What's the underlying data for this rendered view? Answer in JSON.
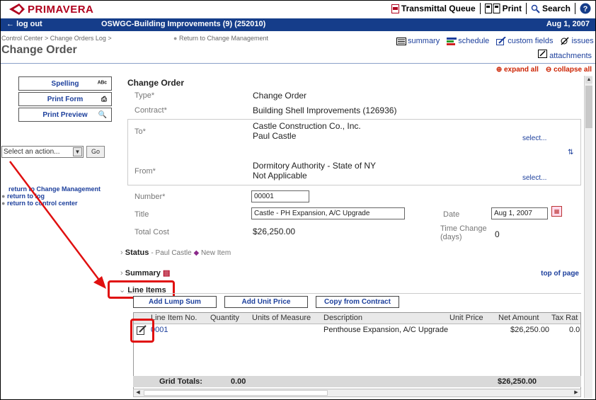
{
  "app": {
    "brand": "PRIMAVERA"
  },
  "topnav": {
    "transmittal": "Transmittal Queue",
    "print": "Print",
    "search": "Search",
    "help": "?"
  },
  "header": {
    "logout": "log out",
    "project": "OSWGC-Building Improvements (9) (252010)",
    "date": "Aug 1, 2007"
  },
  "breadcrumb": {
    "path": "Control Center > Change Orders Log >",
    "return": "Return to Change Management"
  },
  "page_title": "Change Order",
  "rightnav": {
    "summary": "summary",
    "schedule": "schedule",
    "custom_fields": "custom fields",
    "issues": "issues",
    "attachments": "attachments"
  },
  "expand": {
    "expand_all": "expand all",
    "collapse_all": "collapse all"
  },
  "left": {
    "spelling": "Spelling",
    "print_form": "Print Form",
    "print_preview": "Print Preview",
    "action_select": "Select an action...",
    "go": "Go",
    "link_return_change": "return to Change Management",
    "link_return_log": "return to log",
    "link_return_control": "return to control center"
  },
  "form": {
    "title": "Change Order",
    "type_label": "Type*",
    "type_value": "Change Order",
    "contract_label": "Contract*",
    "contract_value": "Building Shell Improvements (126936)",
    "to_label": "To*",
    "to_company": "Castle Construction Co., Inc.",
    "to_person": "Paul Castle",
    "from_label": "From*",
    "from_company": "Dormitory Authority - State of NY",
    "from_person": "Not Applicable",
    "select": "select...",
    "number_label": "Number*",
    "number_value": "00001",
    "title_label": "Title",
    "title_value": "Castle - PH Expansion, A/C Upgrade",
    "date_label": "Date",
    "date_value": "Aug 1, 2007",
    "total_label": "Total Cost",
    "total_value": "$26,250.00",
    "time_label": "Time Change (days)",
    "time_value": "0"
  },
  "status": {
    "label": "Status",
    "person": "Paul Castle",
    "state": "New Item"
  },
  "summary_label": "Summary",
  "top_of_page": "top of page",
  "line_items": {
    "label": "Line Items",
    "add_lump": "Add Lump Sum",
    "add_unit": "Add Unit Price",
    "copy_contract": "Copy from Contract",
    "columns": [
      "Line Item No.",
      "Quantity",
      "Units of Measure",
      "Description",
      "Unit Price",
      "Net Amount",
      "Tax Rat"
    ],
    "rows": [
      {
        "no": "0001",
        "quantity": "",
        "units": "",
        "description": "Penthouse Expansion, A/C Upgrade",
        "unit_price": "",
        "net": "$26,250.00",
        "tax": "0.0"
      }
    ],
    "totals_label": "Grid Totals:",
    "totals_qty": "0.00",
    "totals_net": "$26,250.00"
  },
  "colors": {
    "brand_red": "#b0001e",
    "header_blue": "#153d8a",
    "link_blue": "#1c3f9c",
    "annotation_red": "#e01010"
  }
}
